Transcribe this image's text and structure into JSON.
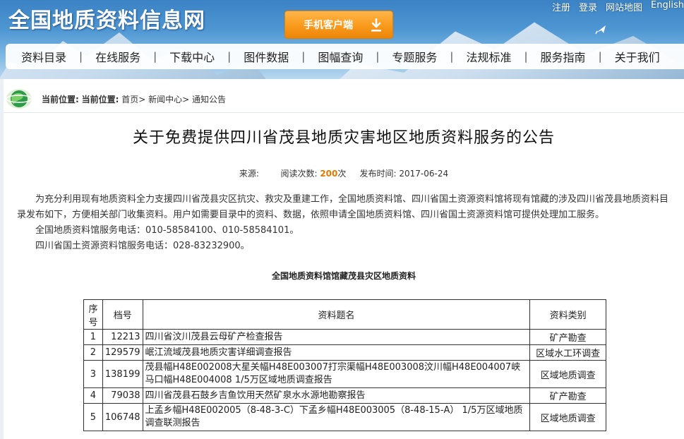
{
  "header": {
    "site_title": "全国地质资料信息网",
    "app_button": "手机客户端",
    "top_links": [
      "注册",
      "登录",
      "网站地图",
      "English"
    ]
  },
  "nav": {
    "items": [
      "资料目录",
      "在线服务",
      "下载中心",
      "图件数据",
      "图幅查询",
      "专题服务",
      "法规标准",
      "服务指南",
      "关于我们"
    ]
  },
  "breadcrumb": {
    "label1": "当前位置:",
    "label2": "当前位置:",
    "path": "首页> 新闻中心> 通知公告"
  },
  "article": {
    "title": "关于免费提供四川省茂县地质灾害地区地质资料服务的公告",
    "source_label": "来源:",
    "reads_label": "阅读次数:",
    "reads_count": "200",
    "reads_unit": "次",
    "date_label": "发布时间:",
    "date": "2017-06-24",
    "paragraph": "为充分利用现有地质资料全力支援四川省茂县灾区抗灾、救灾及重建工作，全国地质资料馆、四川省国土资源资料馆将现有馆藏的涉及四川省茂县地质资料目录发布如下，方便相关部门收集资料。用户如需要目录中的资料、数据，依照申请全国地质资料馆、四川省国土资源资料馆可提供处理加工服务。",
    "phone1": "全国地质资料馆服务电话：010-58584100、010-58584101。",
    "phone2": "四川省国土资源资料馆服务电话：028-83232900。",
    "table_caption": "全国地质资料馆馆藏茂县灾区地质资料"
  },
  "table": {
    "headers": [
      "序号",
      "档号",
      "资料题名",
      "资料类别"
    ],
    "rows": [
      {
        "no": "1",
        "id": "12213",
        "title": "四川省汶川茂县云母矿产检查报告",
        "type": "矿产勘查"
      },
      {
        "no": "2",
        "id": "129579",
        "title": "岷江流域茂县地质灾害详细调查报告",
        "type": "区域水工环调查"
      },
      {
        "no": "3",
        "id": "138199",
        "title": "茂县幅H48E002008大星关幅H48E003007打宗渠幅H48E003008汶川幅H48E004007峡马口幅H48E004008 1/5万区域地质调查报告",
        "type": "区域地质调查"
      },
      {
        "no": "4",
        "id": "79038",
        "title": "四川省茂县石鼓乡吉鱼饮用天然矿泉水水源地勘察报告",
        "type": "矿产勘查"
      },
      {
        "no": "5",
        "id": "106748",
        "title": "上孟乡幅H48E002005（8-48-3-C）下孟乡幅H48E003005（8-48-15-A） 1/5万区域地质调查联测报告",
        "type": "区域地质调查"
      }
    ]
  }
}
